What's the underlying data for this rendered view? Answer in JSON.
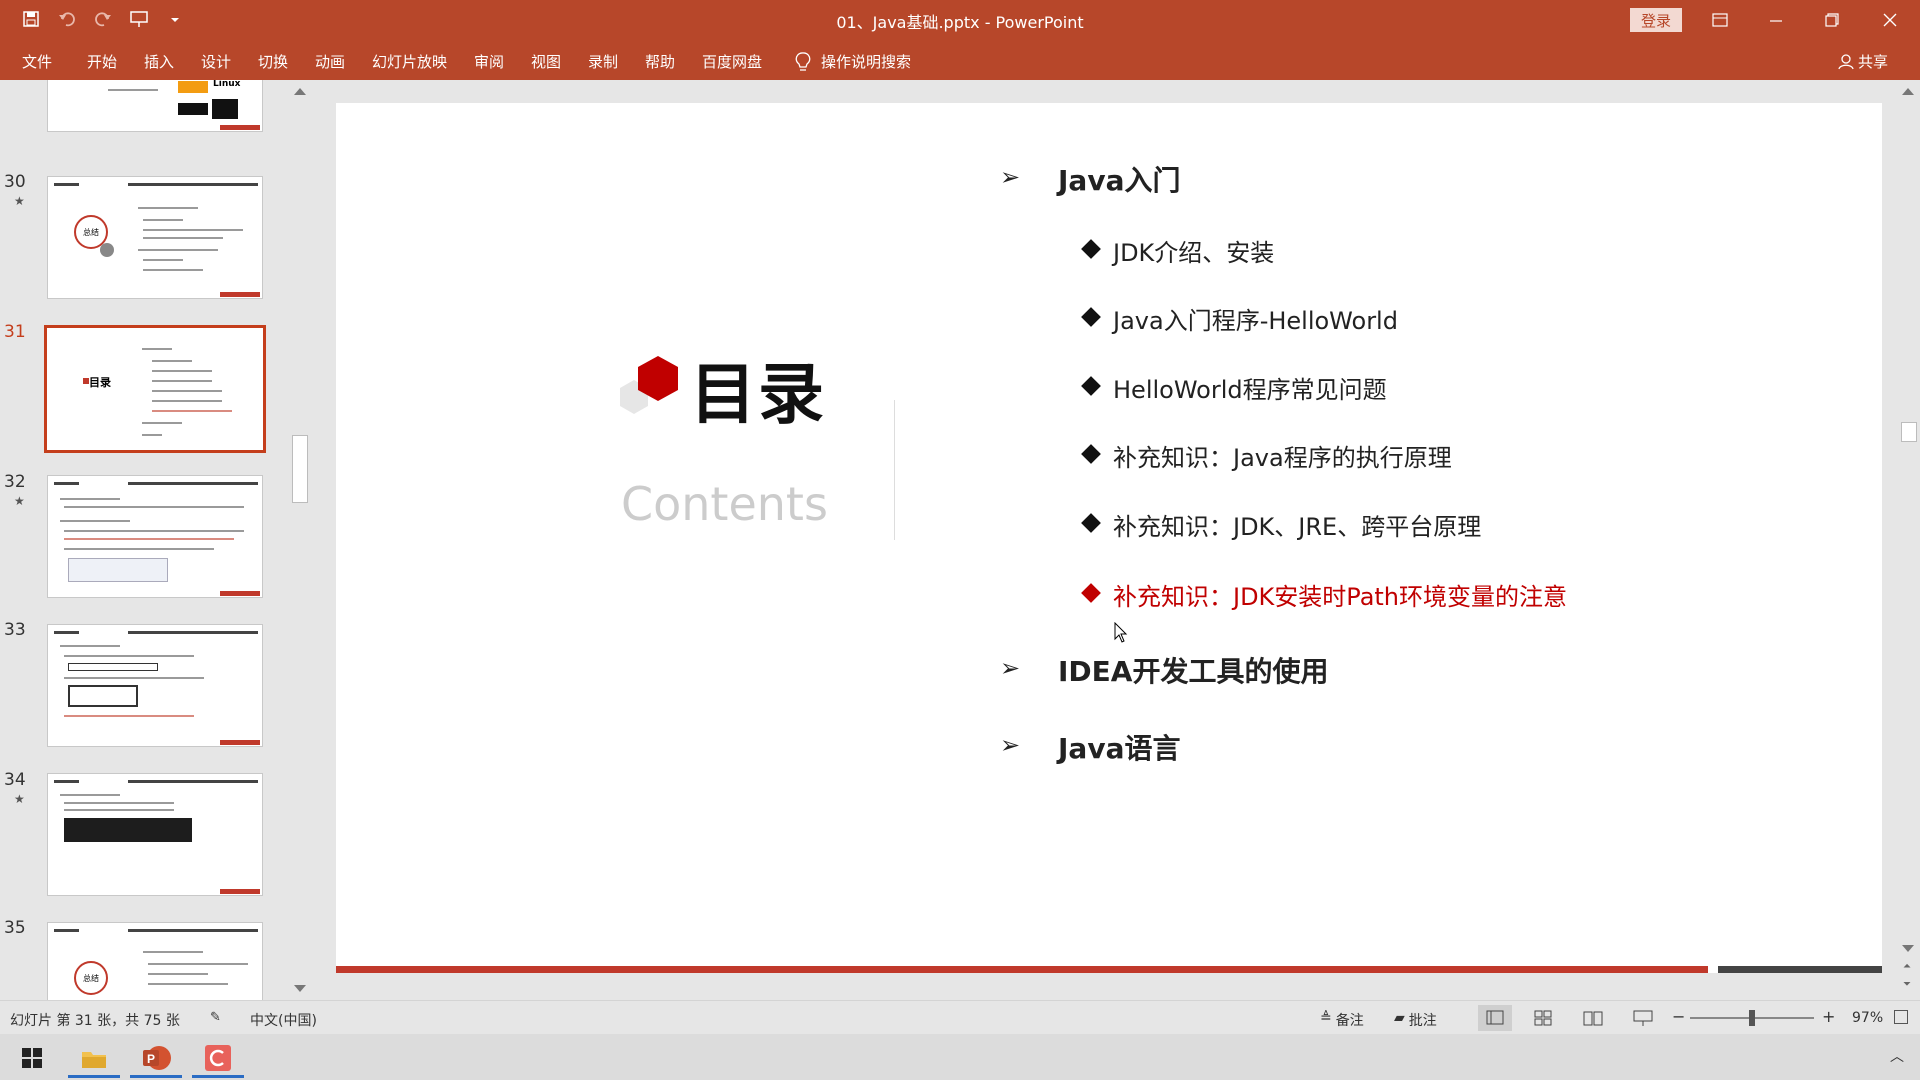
{
  "window": {
    "title": "01、Java基础.pptx  -  PowerPoint",
    "login_label": "登录",
    "controls": [
      "ribbon-display-icon",
      "minimize-icon",
      "restore-icon",
      "close-icon"
    ]
  },
  "menu": {
    "items": [
      "文件",
      "开始",
      "插入",
      "设计",
      "切换",
      "动画",
      "幻灯片放映",
      "审阅",
      "视图",
      "录制",
      "帮助",
      "百度网盘"
    ],
    "tell_me": "操作说明搜索",
    "share": "共享"
  },
  "thumbnails": [
    {
      "number": "30",
      "starred": true
    },
    {
      "number": "31",
      "starred": false,
      "selected": true,
      "label": "目录"
    },
    {
      "number": "32",
      "starred": true
    },
    {
      "number": "33",
      "starred": false
    },
    {
      "number": "34",
      "starred": true
    },
    {
      "number": "35",
      "starred": false
    }
  ],
  "thumb_top_text": "Linux",
  "thumb_30_badge": "总结",
  "thumb_35_badge": "总结",
  "slide": {
    "title": "目录",
    "subtitle": "Contents",
    "sections": [
      {
        "label": "Java入门",
        "items": [
          {
            "text": "JDK介绍、安装",
            "highlight": false
          },
          {
            "text": "Java入门程序-HelloWorld",
            "highlight": false
          },
          {
            "text": "HelloWorld程序常见问题",
            "highlight": false
          },
          {
            "text": "补充知识：Java程序的执行原理",
            "highlight": false
          },
          {
            "text": "补充知识：JDK、JRE、跨平台原理",
            "highlight": false
          },
          {
            "text": "补充知识：JDK安装时Path环境变量的注意",
            "highlight": true
          }
        ]
      },
      {
        "label": "IDEA开发工具的使用",
        "items": []
      },
      {
        "label": "Java语言",
        "items": []
      }
    ],
    "accent_color": "#c00000",
    "bar_color": "#c0392b"
  },
  "status": {
    "slide_info": "幻灯片 第 31 张，共 75 张",
    "language": "中文(中国)",
    "notes": "备注",
    "comments": "批注",
    "zoom": "97%"
  }
}
